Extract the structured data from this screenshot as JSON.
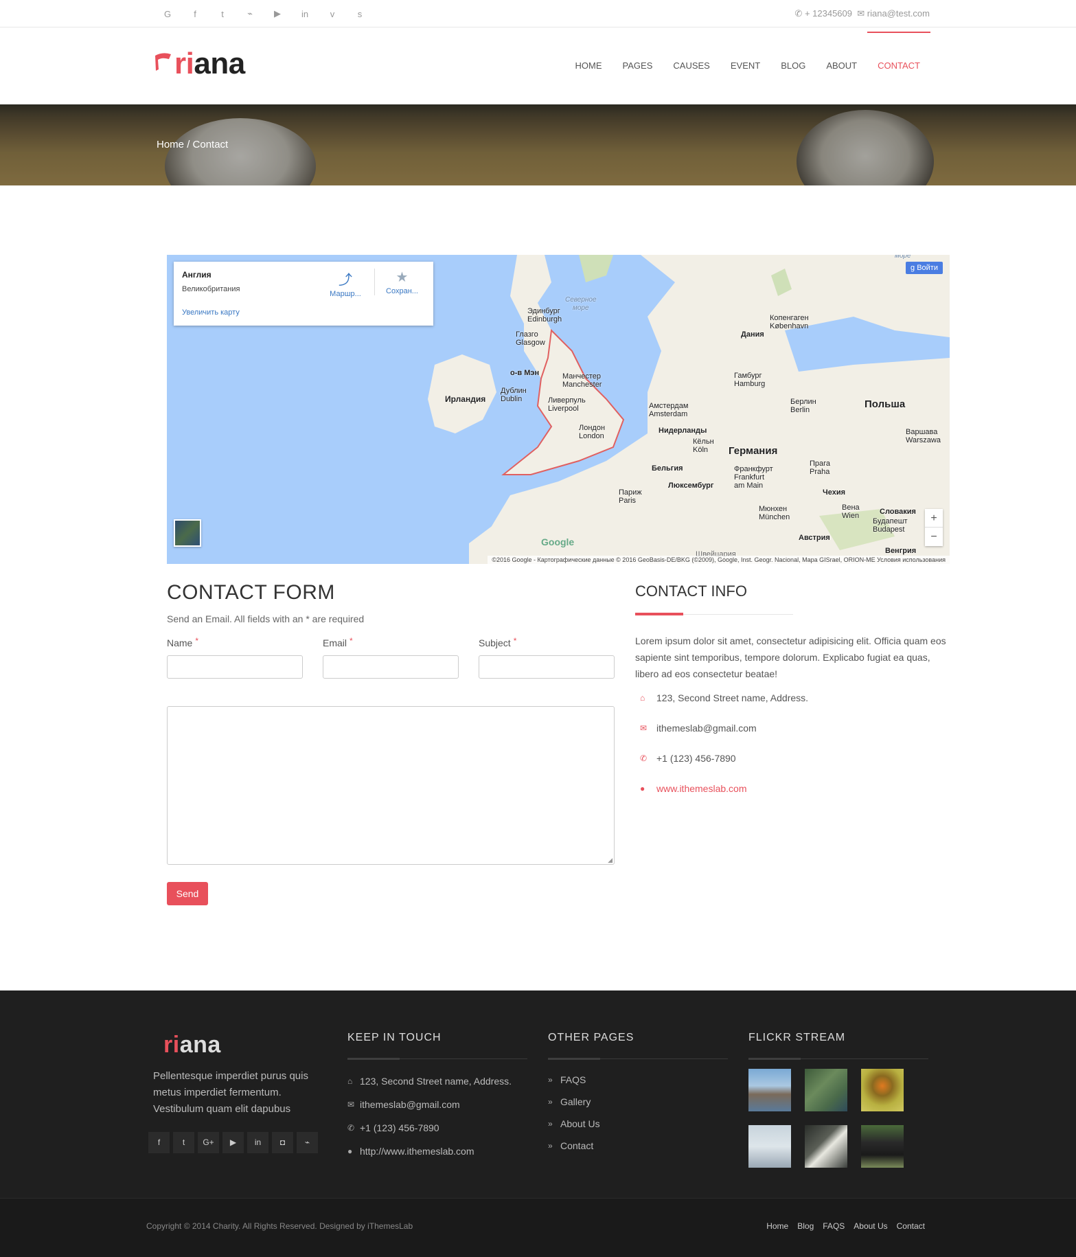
{
  "topbar": {
    "social_icons": [
      "google-icon",
      "facebook-icon",
      "twitter-icon",
      "rss-icon",
      "youtube-icon",
      "linkedin-icon",
      "vimeo-icon",
      "skype-icon"
    ],
    "social_glyphs": [
      "G",
      "f",
      "t",
      "⌁",
      "▶",
      "in",
      "v",
      "s"
    ],
    "phone": "+ 12345609",
    "email": "riana@test.com"
  },
  "header": {
    "logo_r": "ri",
    "logo_rest": "ana",
    "nav": [
      "HOME",
      "PAGES",
      "CAUSES",
      "EVENT",
      "BLOG",
      "ABOUT",
      "CONTACT"
    ],
    "active": "CONTACT"
  },
  "banner": {
    "home": "Home",
    "sep": "/",
    "current": "Contact"
  },
  "map": {
    "card_title": "Англия",
    "card_sub": "Великобритания",
    "card_link": "Увеличить карту",
    "route_label": "Маршр...",
    "save_label": "Сохран...",
    "signin": "Войти",
    "zoom_in": "+",
    "zoom_out": "−",
    "watermark": "Google",
    "attribution": "©2016 Google - Картографические данные © 2016 GeoBasis-DE/BKG (©2009), Google, Inst. Geogr. Nacional, Mapa GISrael, ORION-ME   Условия использования",
    "labels": {
      "north_sea_1": "Северное",
      "north_sea_2": "море",
      "sea_top": "море",
      "edinburgh_ru": "Эдинбург",
      "edinburgh": "Edinburgh",
      "glasgow_ru": "Глазго",
      "glasgow": "Glasgow",
      "isle_of_man": "о-в Мэн",
      "ireland": "Ирландия",
      "dublin_ru": "Дублин",
      "dublin": "Dublin",
      "manchester_ru": "Манчестер",
      "manchester": "Manchester",
      "liverpool_ru": "Ливерпуль",
      "liverpool": "Liverpool",
      "london_ru": "Лондон",
      "london": "London",
      "copenhagen_ru": "Копенгаген",
      "copenhagen": "København",
      "denmark": "Дания",
      "hamburg_ru": "Гамбург",
      "hamburg": "Hamburg",
      "amsterdam_ru": "Амстердам",
      "amsterdam": "Amsterdam",
      "netherlands": "Нидерланды",
      "berlin_ru": "Берлин",
      "berlin": "Berlin",
      "poland": "Польша",
      "warsaw_ru": "Варшава",
      "warsaw": "Warszawa",
      "cologne_ru": "Кёльн",
      "cologne": "Köln",
      "germany": "Германия",
      "belgium": "Бельгия",
      "frankfurt_ru": "Франкфурт",
      "frankfurt": "Frankfurt",
      "am_main": "am Main",
      "prague_ru": "Прага",
      "prague": "Praha",
      "luxembourg": "Люксембург",
      "paris_ru": "Париж",
      "paris": "Paris",
      "czechia": "Чехия",
      "munich_ru": "Мюнхен",
      "munich": "München",
      "vienna_ru": "Вена",
      "vienna": "Wien",
      "slovakia": "Словакия",
      "budapest_ru": "Будапешт",
      "budapest": "Budapest",
      "austria": "Австрия",
      "hungary": "Венгрия",
      "switzerland": "Швейцария"
    }
  },
  "form": {
    "title": "CONTACT FORM",
    "subtitle": "Send an Email. All fields with an * are required",
    "name_label": "Name",
    "email_label": "Email",
    "subject_label": "Subject",
    "req": "*",
    "send": "Send"
  },
  "info": {
    "title": "CONTACT INFO",
    "text": "Lorem ipsum dolor sit amet, consectetur adipisicing elit. Officia quam eos sapiente sint temporibus, tempore dolorum. Explicabo fugiat ea quas, libero ad eos consectetur beatae!",
    "address": "123, Second Street name, Address.",
    "email": "ithemeslab@gmail.com",
    "phone": "+1 (123) 456-7890",
    "website": "www.ithemeslab.com"
  },
  "footer": {
    "logo_r": "ri",
    "logo_rest": "ana",
    "desc": "Pellentesque imperdiet purus quis metus imperdiet fermentum. Vestibulum quam elit dapubus",
    "social_glyphs": [
      "f",
      "t",
      "G+",
      "▶",
      "in",
      "◘",
      "⌁"
    ],
    "keep_title": "KEEP IN TOUCH",
    "address": "123, Second Street name, Address.",
    "email": "ithemeslab@gmail.com",
    "phone": "+1 (123) 456-7890",
    "website": "http://www.ithemeslab.com",
    "pages_title": "OTHER PAGES",
    "pages": [
      "FAQS",
      "Gallery",
      "About Us",
      "Contact"
    ],
    "flickr_title": "FLICKR STREAM"
  },
  "bottom": {
    "copyright": "Copyright © 2014 Charity. All Rights Reserved. Designed by iThemesLab",
    "links": [
      "Home",
      "Blog",
      "FAQS",
      "About Us",
      "Contact"
    ]
  },
  "colors": {
    "accent": "#e8505b",
    "footer_bg": "#1f1f1f"
  }
}
